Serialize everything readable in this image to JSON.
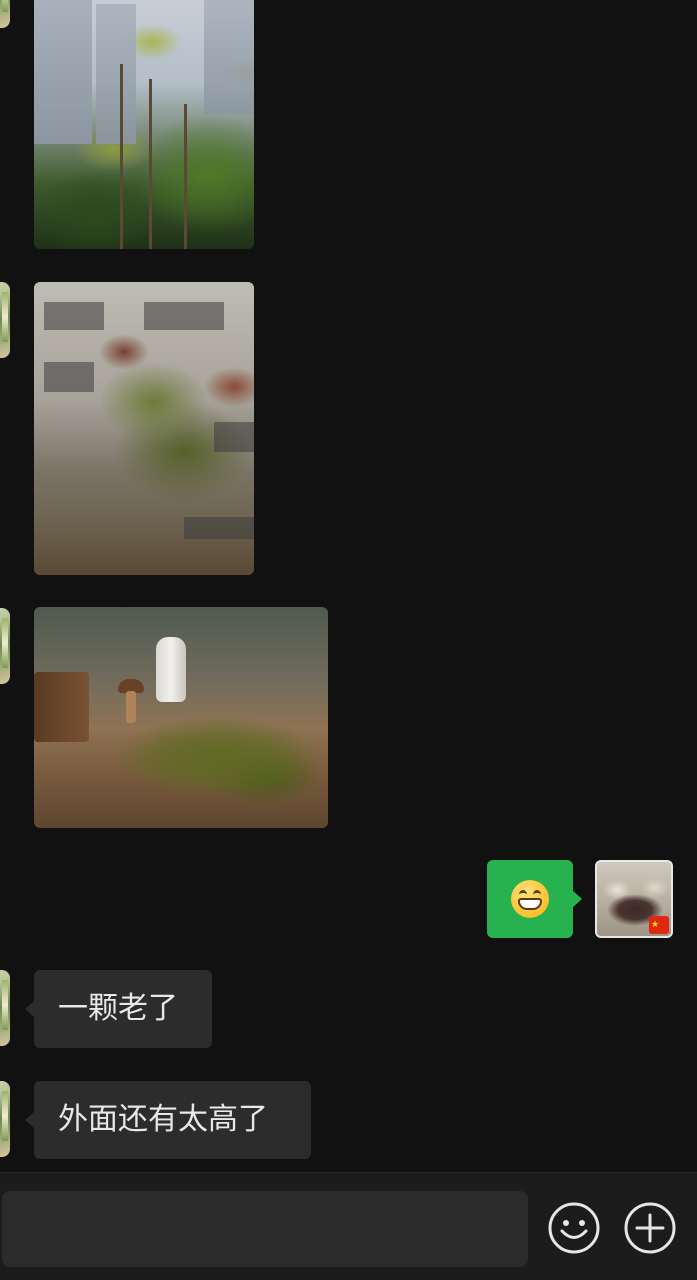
{
  "messages": {
    "photo_1": {
      "alt": "toona-sprouts-photo-1"
    },
    "photo_2": {
      "alt": "toona-sprouts-photo-2"
    },
    "photo_3": {
      "alt": "harvested-toona-photo"
    },
    "outgoing_emoji": {
      "icon": "grinning-face-emoji"
    },
    "incoming_text_1": "一颗老了",
    "incoming_text_2": "外面还有太高了"
  },
  "input_bar": {
    "input_value": "",
    "emoji_button_icon": "smiley-icon",
    "more_button_icon": "plus-circle-icon"
  },
  "colors": {
    "background": "#111111",
    "outgoing_bubble": "#27b14f",
    "incoming_bubble": "#2c2c2c",
    "input_bar": "#1c1c1c",
    "icon_stroke": "#e6e6e6"
  }
}
